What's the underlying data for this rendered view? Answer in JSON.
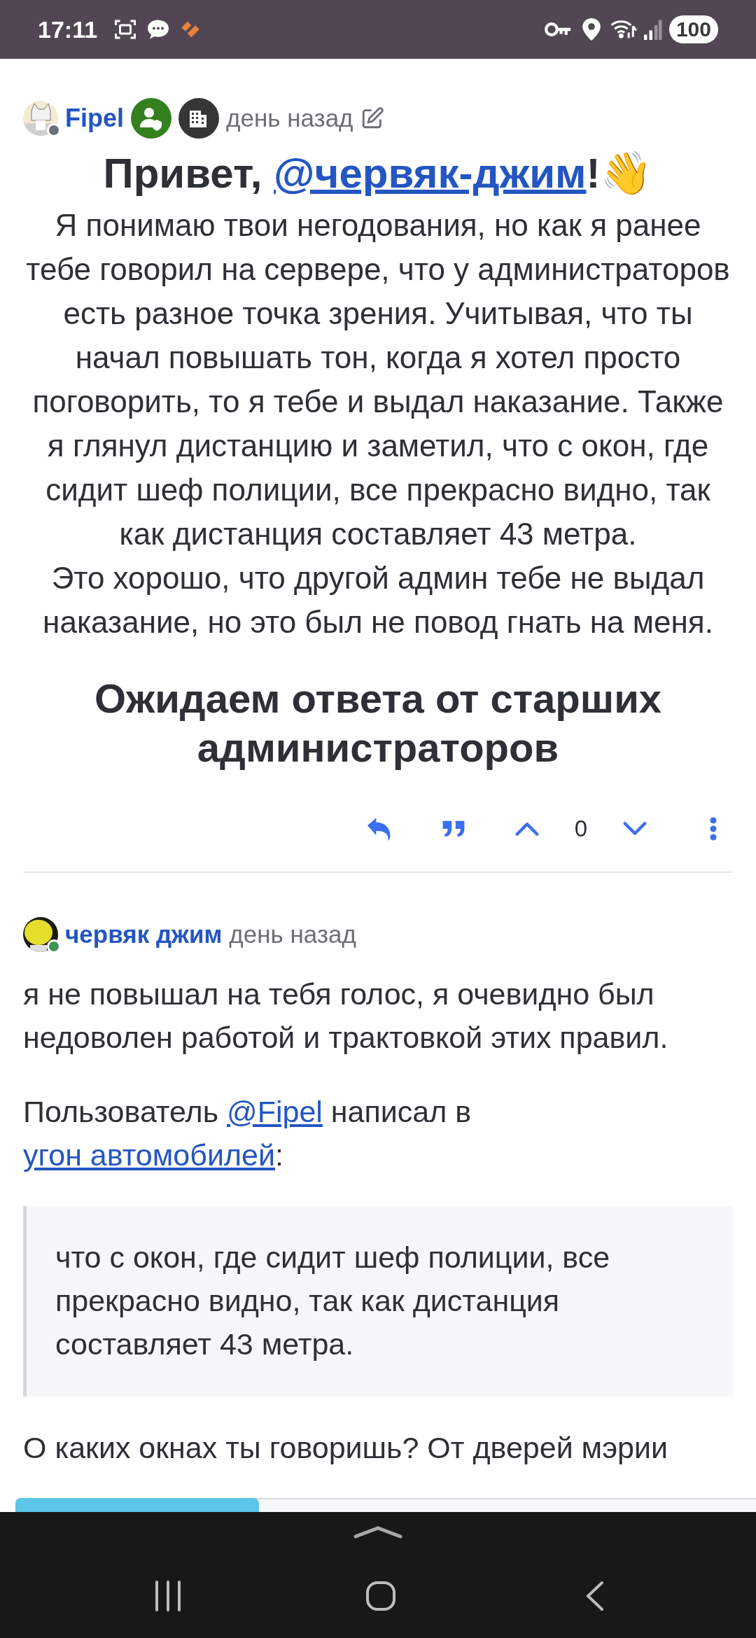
{
  "status_bar": {
    "time": "17:11",
    "battery": "100"
  },
  "posts": [
    {
      "author": "Fipel",
      "online": false,
      "badges": [
        {
          "kind": "moderator"
        },
        {
          "kind": "city"
        }
      ],
      "time": "день назад",
      "editable": true,
      "title": [
        {
          "kind": "text",
          "text": "Привет, "
        },
        {
          "kind": "link",
          "text": "@червяк-джим"
        },
        {
          "kind": "text",
          "text": "!👋"
        }
      ],
      "paragraphs": [
        "Я понимаю твои негодования, но как я ранее тебе говорил на сервере, что у администраторов есть разное точка зрения. Учитывая, что ты начал повышать тон, когда я хотел просто поговорить, то я тебе и выдал наказание. Также я глянул дистанцию и заметил, что с окон, где сидит шеф полиции, все прекрасно видно, так как дистанция составляет 43 метра.",
        "Это хорошо, что другой админ тебе не выдал наказание, но это был не повод гнать на меня."
      ],
      "heading": "Ожидаем ответа от старших администраторов",
      "votes": "0"
    },
    {
      "author": "червяк джим",
      "online": true,
      "time": "день назад",
      "paragraph": "я не повышал на тебя голос, я очевидно был недоволен работой и трактовкой этих правил.",
      "quote_intro": [
        {
          "kind": "text",
          "text": "Пользователь "
        },
        {
          "kind": "link",
          "text": "@Fipel"
        },
        {
          "kind": "text",
          "text": " написал в "
        },
        {
          "kind": "link",
          "text": "угон автомобилей"
        },
        {
          "kind": "text",
          "text": ":"
        }
      ],
      "quote": "что с окон, где сидит шеф полиции, все прекрасно видно, так как дистанция составляет 43 метра.",
      "cut_line": "О каких окнах ты говоришь? От дверей мэрии"
    }
  ]
}
